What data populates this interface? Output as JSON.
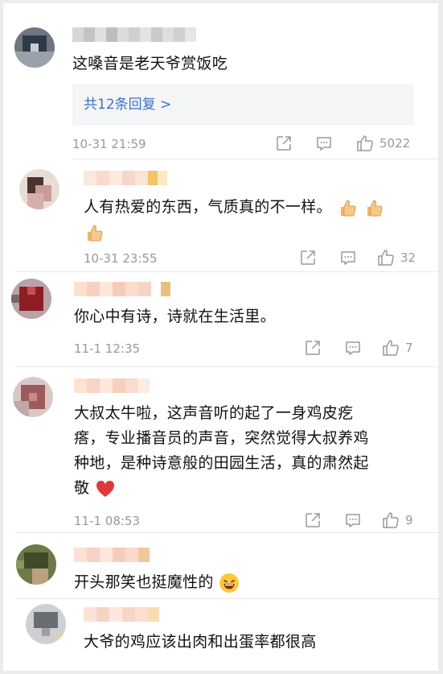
{
  "comments": [
    {
      "text": "这嗓音是老天爷赏饭吃",
      "replies_label": "共12条回复 >",
      "time": "10-31 21:59",
      "likes": "5022"
    },
    {
      "text": "人有热爱的东西，气质真的不一样。",
      "time": "10-31 23:55",
      "likes": "32"
    },
    {
      "text": "你心中有诗，诗就在生活里。",
      "time": "11-1 12:35",
      "likes": "7"
    },
    {
      "text_lines": [
        "大叔太牛啦，这声音听的起了一身鸡皮疙",
        "瘩，专业播音员的声音，突然觉得大叔养鸡",
        "种地，是种诗意般的田园生活，真的肃然起",
        "敬"
      ],
      "time": "11-1 08:53",
      "likes": "9"
    },
    {
      "text": "开头那笑也挺魔性的"
    },
    {
      "text": "大爷的鸡应该出肉和出蛋率都很高"
    }
  ],
  "icons": {
    "share": "share-icon",
    "comment": "comment-icon",
    "like": "thumbs-up-icon",
    "thumb_emoji": "thumbs-up-emoji-icon",
    "heart_emoji": "heart-emoji-icon",
    "laugh_emoji": "laugh-emoji-icon"
  },
  "colors": {
    "link": "#3a74c4",
    "meta_gray": "#999999",
    "reply_bg": "#f4f5f7",
    "heart": "#e0383e"
  }
}
